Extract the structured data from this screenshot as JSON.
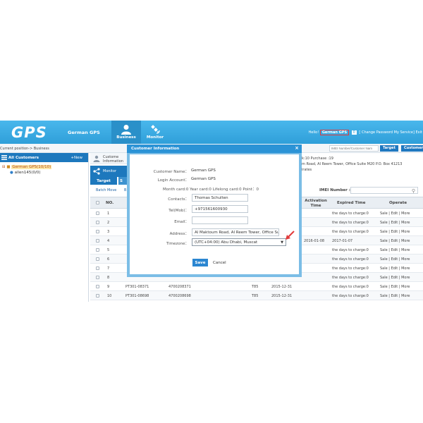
{
  "app": {
    "logo": "GPS",
    "company": "German GPS",
    "nav": [
      {
        "label": "Business"
      },
      {
        "label": "Monitor"
      }
    ],
    "hello_prefix": "Hello!",
    "user": "German GPS",
    "chip": "0",
    "links": "[ Change Password  My Service] Exit"
  },
  "subbar": {
    "breadcrumb": "Current position-> Business",
    "search_placeholder": "IMEI Number/Customer Nam",
    "target_label": "Target",
    "customer_label": "Customer"
  },
  "sidebar": {
    "title": "All Customers",
    "new_label": "+New",
    "tree": [
      {
        "label": "German GPS(10/10)"
      },
      {
        "label": "allen145(0/0)"
      }
    ]
  },
  "vtabs": [
    {
      "label": "Custome Information"
    },
    {
      "label": "Monitor"
    }
  ],
  "strip": {
    "target": "Target",
    "s": "S",
    "batch_move": "Batch Move",
    "b": "B"
  },
  "right_info": {
    "line1": "k:10 Purchase :19",
    "line2": "m Road, Al Reem Tower, Office Suite M20 P.O. Box 41213",
    "line3": "irates"
  },
  "imei": {
    "label": "IMEI Number :"
  },
  "table": {
    "headers": {
      "no": "NO.",
      "activation_time": "Activation Time",
      "expired_time": "Expired Time",
      "operate": "Operate"
    },
    "rows": [
      {
        "no": "1",
        "name": "",
        "imei": "",
        "model": "",
        "date": "",
        "activation": "",
        "expired": "the days to charge:0",
        "ops": "Sale |  Edit |  More"
      },
      {
        "no": "2",
        "name": "",
        "imei": "",
        "model": "",
        "date": "",
        "activation": "",
        "expired": "the days to charge:0",
        "ops": "Sale |  Edit |  More"
      },
      {
        "no": "3",
        "name": "",
        "imei": "",
        "model": "",
        "date": "",
        "activation": "",
        "expired": "the days to charge:0",
        "ops": "Sale |  Edit |  More"
      },
      {
        "no": "4",
        "name": "",
        "imei": "",
        "model": "",
        "date": "",
        "activation": "2016-01-08",
        "expired": "2017-01-07",
        "ops": "Sale |  Edit |  More"
      },
      {
        "no": "5",
        "name": "",
        "imei": "",
        "model": "",
        "date": "",
        "activation": "",
        "expired": "the days to charge:0",
        "ops": "Sale |  Edit |  More"
      },
      {
        "no": "6",
        "name": "",
        "imei": "",
        "model": "",
        "date": "",
        "activation": "",
        "expired": "the days to charge:0",
        "ops": "Sale |  Edit |  More"
      },
      {
        "no": "7",
        "name": "",
        "imei": "",
        "model": "",
        "date": "",
        "activation": "",
        "expired": "the days to charge:0",
        "ops": "Sale |  Edit |  More"
      },
      {
        "no": "8",
        "name": "",
        "imei": "",
        "model": "",
        "date": "",
        "activation": "",
        "expired": "the days to charge:0",
        "ops": "Sale |  Edit |  More"
      },
      {
        "no": "9",
        "name": "PT301-08371",
        "imei": "4700208371",
        "model": "T85",
        "date": "2015-12-31",
        "activation": "",
        "expired": "the days to charge:0",
        "ops": "Sale |  Edit |  More"
      },
      {
        "no": "10",
        "name": "PT301-08698",
        "imei": "4700208698",
        "model": "T85",
        "date": "2015-12-31",
        "activation": "",
        "expired": "the days to charge:0",
        "ops": "Sale |  Edit |  More"
      }
    ]
  },
  "dialog": {
    "title": "Customer Information",
    "close": "×",
    "customer_name_label": "Customer Name：",
    "customer_name": "German GPS",
    "login_account_label": "Login Account：",
    "login_account": "German GPS",
    "month_card_label": "Month card:0",
    "year_card_label": "Year card:0",
    "lifelong_card_label": "Lifelong card:0",
    "point_label": "Point：0",
    "contacts_label": "Contacts：",
    "contacts": "Thomas Schulten",
    "tel_label": "Tel(Mob)：",
    "tel": "+971561600930",
    "email_label": "Email：",
    "email": "",
    "address_label": "Address：",
    "address": "Al Maktoum Road, Al Reem Tower, Office Suite M2",
    "timezone_label": "Timezone：",
    "timezone": "(UTC+04:00) Abu Dhabi, Muscat",
    "save": "Save",
    "cancel": "Cancel"
  },
  "colors": {
    "header": "#2f9fd9",
    "accent": "#1d78bd",
    "highlight_arrow": "#e23b3b"
  }
}
